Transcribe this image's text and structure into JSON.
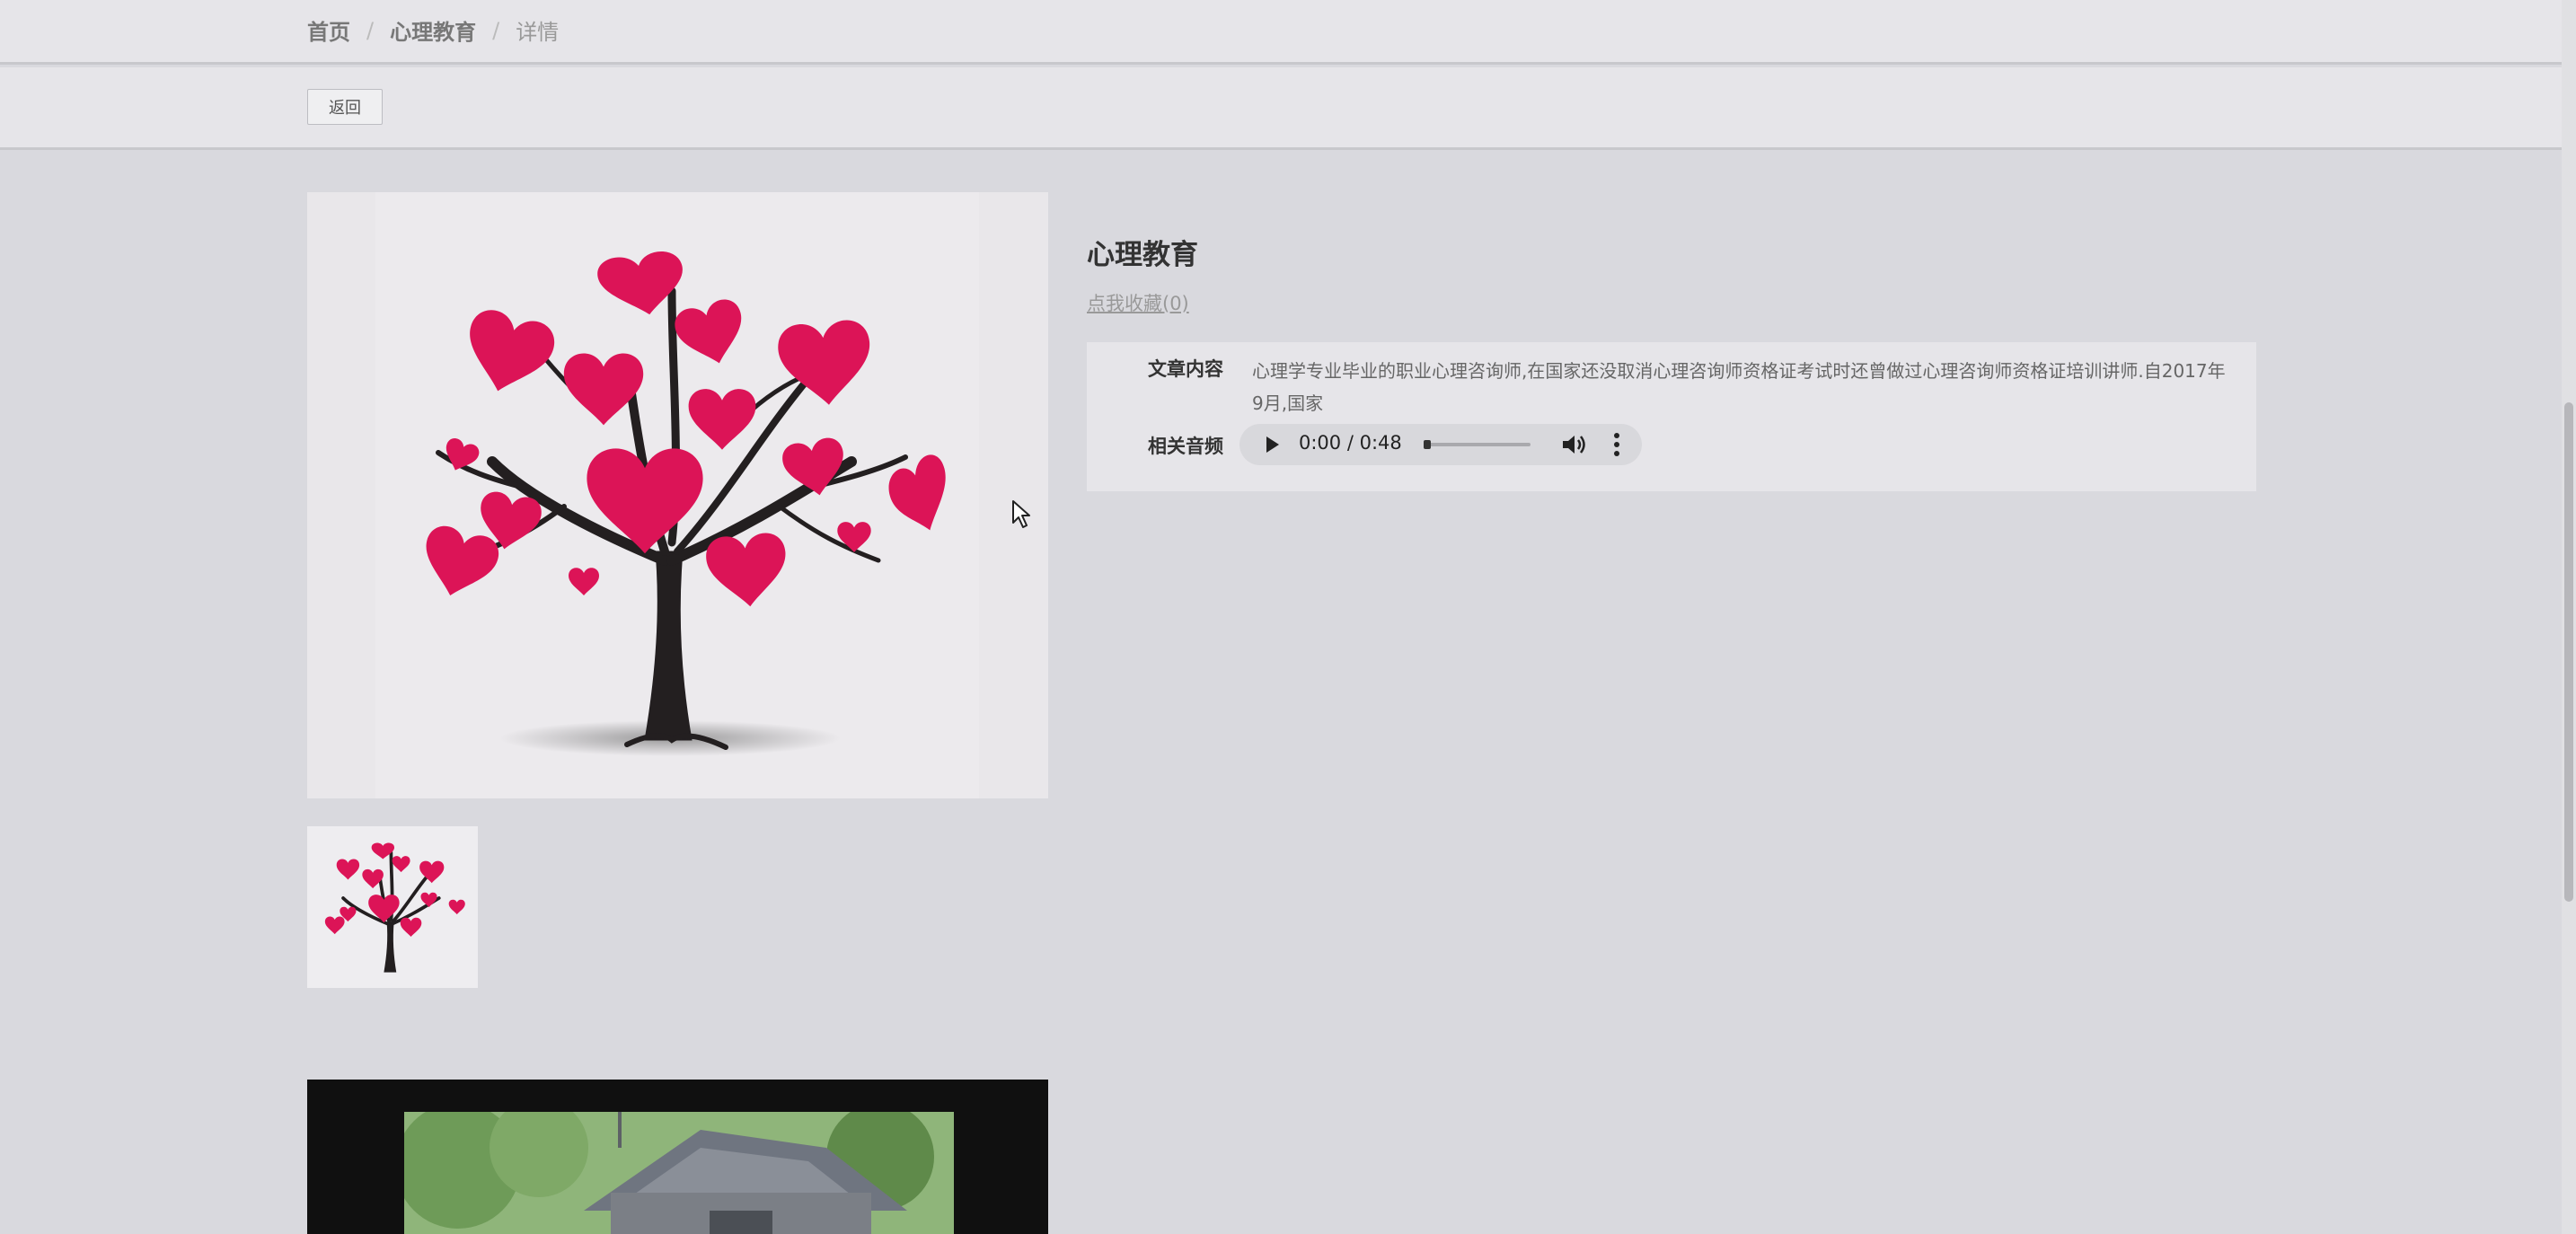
{
  "breadcrumb": {
    "home": "首页",
    "category": "心理教育",
    "current": "详情",
    "separator": "/"
  },
  "toolbar": {
    "back_label": "返回"
  },
  "detail": {
    "title": "心理教育",
    "favorite_link": "点我收藏(0)",
    "content_label": "文章内容",
    "content_text": "心理学专业毕业的职业心理咨询师,在国家还没取消心理咨询师资格证考试时还曾做过心理咨询师资格证培训讲师.自2017年9月,国家",
    "audio_label": "相关音频"
  },
  "audio": {
    "time": "0:00 / 0:48",
    "progress": 0.0
  },
  "images": {
    "main": "heart-tree-illustration",
    "thumbnail": "heart-tree-thumbnail",
    "video": "anime-video-frame"
  },
  "colors": {
    "heart": "#dc1457",
    "trunk": "#231f20",
    "background": "#d9d9de"
  }
}
